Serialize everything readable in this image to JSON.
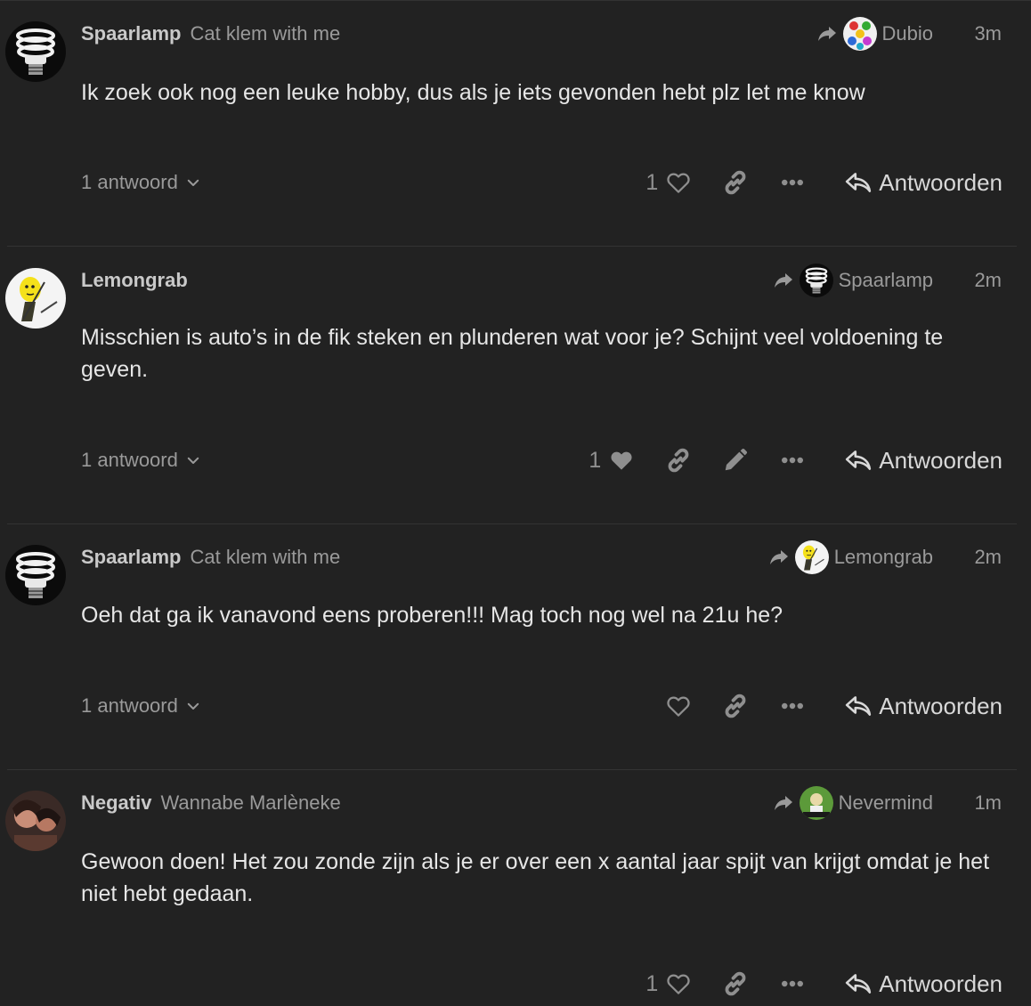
{
  "posts": [
    {
      "username": "Spaarlamp",
      "user_title": "Cat klem with me",
      "avatar": "lightbulb-avatar",
      "reply_to": "Dubio",
      "reply_to_avatar": "colorful-buttons-avatar",
      "time": "3m",
      "text": "Ik zoek ook nog een leuke hobby, dus als je iets gevonden hebt plz let me know",
      "replies": "1 antwoord",
      "likes": "1",
      "liked": false,
      "has_edit": false
    },
    {
      "username": "Lemongrab",
      "user_title": "",
      "avatar": "lemon-avatar",
      "reply_to": "Spaarlamp",
      "reply_to_avatar": "lightbulb-avatar",
      "time": "2m",
      "text": "Misschien is auto’s in de fik steken en plunderen wat voor je? Schijnt veel voldoening te geven.",
      "replies": "1 antwoord",
      "likes": "1",
      "liked": true,
      "has_edit": true
    },
    {
      "username": "Spaarlamp",
      "user_title": "Cat klem with me",
      "avatar": "lightbulb-avatar",
      "reply_to": "Lemongrab",
      "reply_to_avatar": "lemon-avatar",
      "time": "2m",
      "text": "Oeh dat ga ik vanavond eens proberen!!! Mag toch nog wel na 21u he?",
      "replies": "1 antwoord",
      "likes": "",
      "liked": false,
      "has_edit": false
    },
    {
      "username": "Negativ",
      "user_title": "Wannabe Marlèneke",
      "avatar": "photo-avatar",
      "reply_to": "Nevermind",
      "reply_to_avatar": "nevermind-avatar",
      "time": "1m",
      "text": "Gewoon doen! Het zou zonde zijn als je er over een x aantal jaar spijt van krijgt omdat je het niet hebt gedaan.",
      "replies": "",
      "likes": "1",
      "liked": false,
      "has_edit": false
    }
  ],
  "reply_label": "Antwoorden",
  "colors": {
    "background": "#222222",
    "text": "#e6e6e6",
    "muted": "#9a9a9a",
    "divider": "#333333"
  }
}
